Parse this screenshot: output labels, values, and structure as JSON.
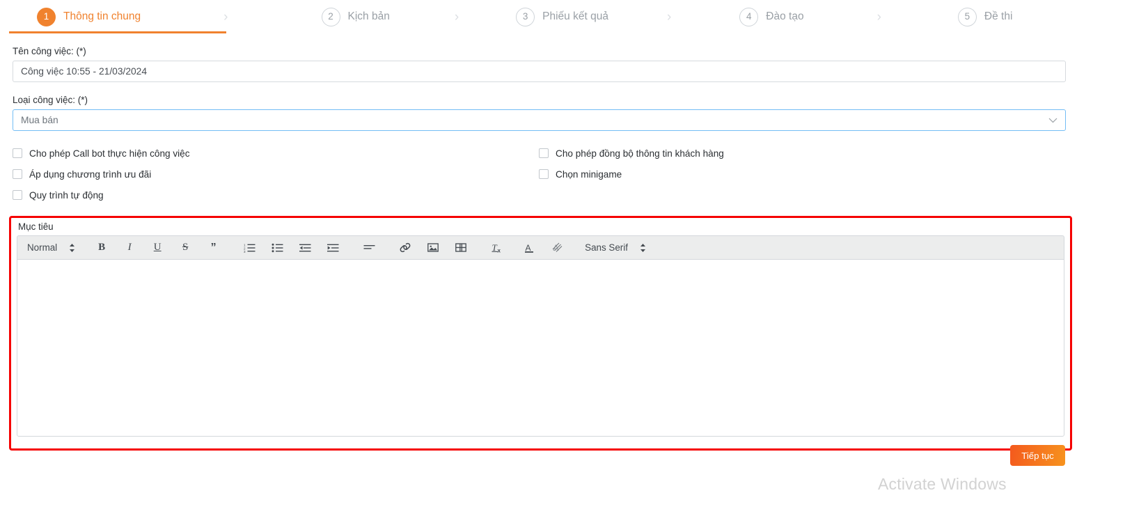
{
  "stepper": {
    "steps": [
      {
        "num": "1",
        "label": "Thông tin chung",
        "state": "active"
      },
      {
        "num": "2",
        "label": "Kịch bản",
        "state": "idle"
      },
      {
        "num": "3",
        "label": "Phiếu kết quả",
        "state": "idle"
      },
      {
        "num": "4",
        "label": "Đào tạo",
        "state": "idle"
      },
      {
        "num": "5",
        "label": "Đề thi",
        "state": "idle"
      }
    ],
    "separator": "›",
    "active_color": "#f0822e",
    "idle_color": "#9aa0a6"
  },
  "form": {
    "job_name_label": "Tên công việc: (*)",
    "job_name_value": "Công việc 10:55 - 21/03/2024",
    "job_type_label": "Loại công việc: (*)",
    "job_type_value": "Mua bán",
    "job_type_chevron": "⌄",
    "select_border_color": "#73bdf5"
  },
  "checkboxes": {
    "left": [
      {
        "label": "Cho phép Call bot thực hiện công việc",
        "checked": false
      },
      {
        "label": "Áp dụng chương trình ưu đãi",
        "checked": false
      },
      {
        "label": "Quy trình tự động",
        "checked": false
      }
    ],
    "right": [
      {
        "label": "Cho phép đồng bộ thông tin khách hàng",
        "checked": false
      },
      {
        "label": "Chọn minigame",
        "checked": false
      }
    ]
  },
  "editor": {
    "title": "Mục tiêu",
    "highlight_color": "#f50000",
    "content": "",
    "toolbar": {
      "format_picker": "Normal",
      "font_picker": "Sans Serif",
      "picker_arrow": "↕",
      "bold": "B",
      "italic": "I",
      "underline": "U",
      "strike": "S",
      "blockquote": "”",
      "clear_format": "T",
      "clear_format_sub": "x",
      "font_color": "A",
      "items": [
        "format-picker",
        "bold",
        "italic",
        "underline",
        "strike",
        "blockquote",
        "ordered-list",
        "bullet-list",
        "outdent",
        "indent",
        "align",
        "link",
        "image",
        "video",
        "clear-format",
        "font-color",
        "highlight-color",
        "font-picker"
      ]
    }
  },
  "footer": {
    "submit_label": "Tiếp tục",
    "watermark": "Activate Windows"
  }
}
